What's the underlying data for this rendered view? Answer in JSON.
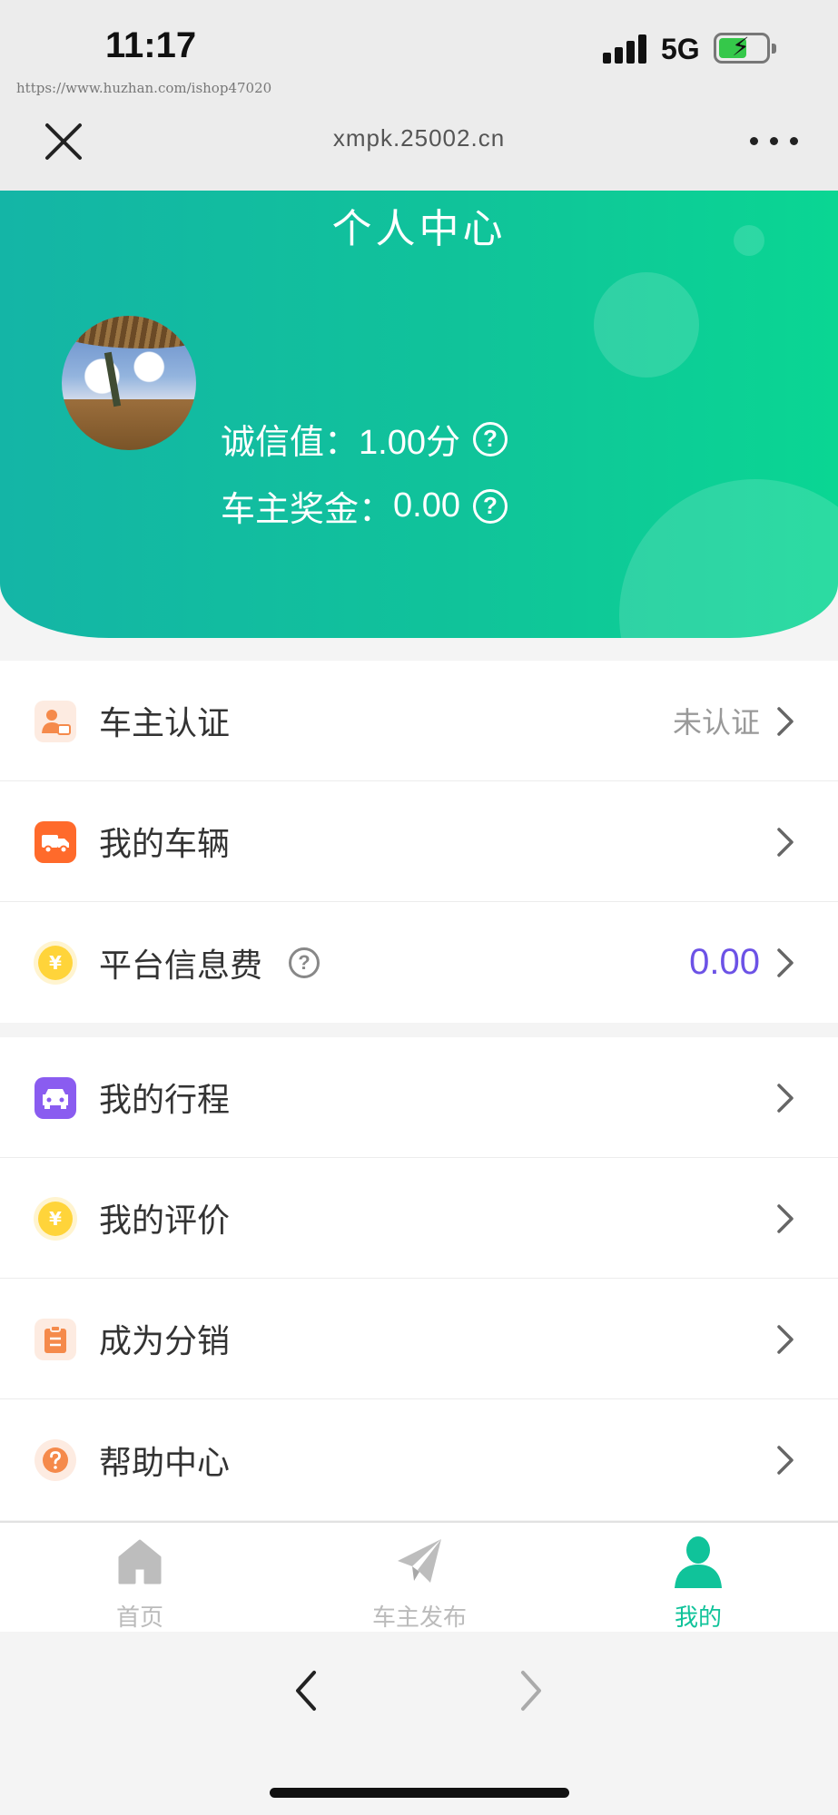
{
  "status_bar": {
    "time": "11:17",
    "network": "5G"
  },
  "watermark": "https://www.huzhan.com/ishop47020",
  "browser": {
    "url": "xmpk.25002.cn"
  },
  "header": {
    "title": "个人中心",
    "credit_label": "诚信值：",
    "credit_value": "1.00分",
    "bonus_label": "车主奖金：",
    "bonus_value": "0.00",
    "question_mark": "?"
  },
  "menu_group_1": [
    {
      "label": "车主认证",
      "right_text": "未认证",
      "icon": "driver-badge-icon"
    },
    {
      "label": "我的车辆",
      "right_text": "",
      "icon": "truck-icon"
    },
    {
      "label": "平台信息费",
      "right_text": "0.00",
      "icon": "yen-coin-icon"
    }
  ],
  "menu_group_2": [
    {
      "label": "我的行程",
      "icon": "car-icon"
    },
    {
      "label": "我的评价",
      "icon": "yen-coin-icon"
    },
    {
      "label": "成为分销",
      "icon": "clipboard-icon"
    },
    {
      "label": "帮助中心",
      "icon": "help-circle-icon"
    }
  ],
  "tabbar": {
    "home": "首页",
    "publish": "车主发布",
    "mine": "我的"
  },
  "colors": {
    "brand_green": "#10c39a",
    "amount_purple": "#6c52e6"
  },
  "yen_symbol": "¥"
}
